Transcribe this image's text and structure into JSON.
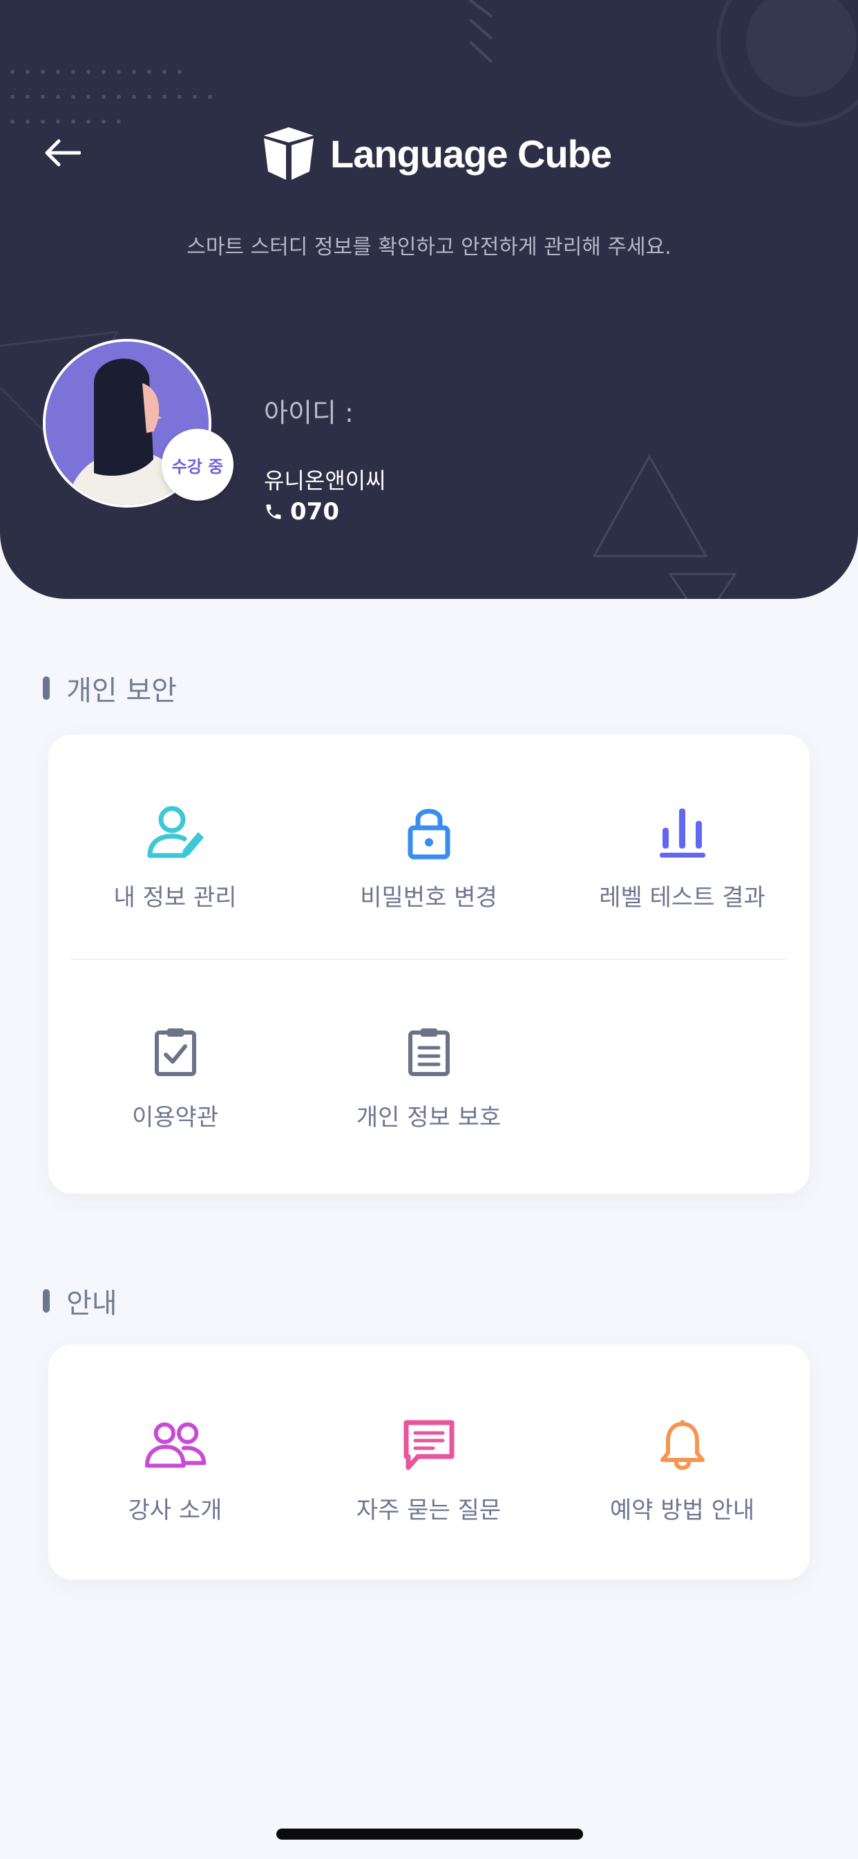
{
  "header": {
    "brand": "Language Cube",
    "subtitle": "스마트 스터디 정보를 확인하고 안전하게 관리해 주세요.",
    "back_icon": "arrow-left-icon"
  },
  "profile": {
    "status_badge": "수강 중",
    "id_label": "아이디 :",
    "company": "유니온앤이씨",
    "phone": "070"
  },
  "sections": {
    "security": {
      "title": "개인 보안",
      "items": [
        {
          "label": "내 정보 관리",
          "icon": "user-edit-icon",
          "color": "#3ec7d6"
        },
        {
          "label": "비밀번호 변경",
          "icon": "lock-icon",
          "color": "#3b8cef"
        },
        {
          "label": "레벨 테스트 결과",
          "icon": "bar-chart-icon",
          "color": "#6366f1"
        },
        {
          "label": "이용약관",
          "icon": "clipboard-check-icon",
          "color": "#6b7388"
        },
        {
          "label": "개인 정보 보호",
          "icon": "clipboard-list-icon",
          "color": "#6b7388"
        }
      ]
    },
    "info": {
      "title": "안내",
      "items": [
        {
          "label": "강사 소개",
          "icon": "users-icon",
          "color": "#c84bd8"
        },
        {
          "label": "자주 묻는 질문",
          "icon": "message-icon",
          "color": "#e9559b"
        },
        {
          "label": "예약 방법 안내",
          "icon": "bell-icon",
          "color": "#f59650"
        }
      ]
    }
  }
}
